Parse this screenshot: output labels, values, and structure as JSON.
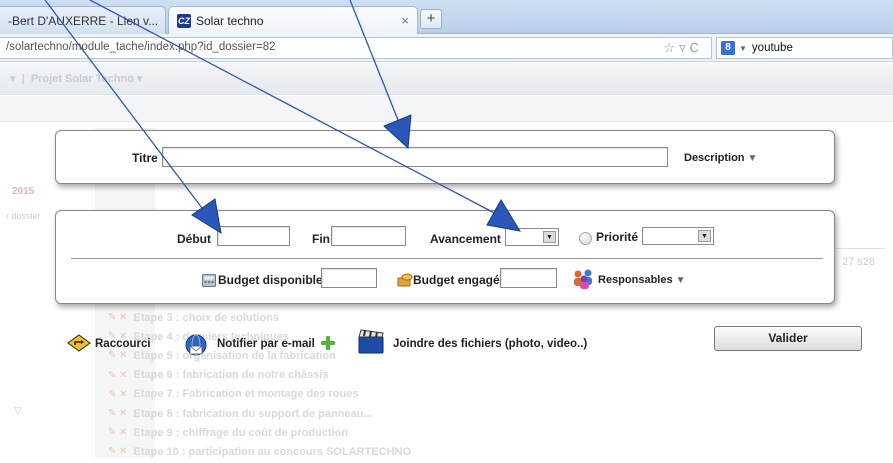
{
  "browser": {
    "tabs": [
      {
        "label": "-Bert D'AUXERRE - Lien v...",
        "active": false
      },
      {
        "label": "Solar techno",
        "active": true
      }
    ],
    "url": "/solartechno/module_tache/index.php?id_dossier=82",
    "search_text": "youtube"
  },
  "background": {
    "breadcrumb": "Projet Solar Techno",
    "year": "2015",
    "dossier": "r dossier",
    "week_numbers": "27  s28",
    "steps": [
      "Etape 3 : choix de solutions",
      "Etape 4 : dossiers techniques",
      "Etape 5 : organisation de la fabrication",
      "Etape 6 : fabrication de notre châssis",
      "Etape 7 : Fabrication et montage des roues",
      "Etape 8 : fabrication du support de panneau...",
      "Etape 9 : chiffrage du coût de production",
      "Etape 10 : participation au concours SOLARTECHNO"
    ]
  },
  "form": {
    "titre_label": "Titre",
    "titre_value": "",
    "description_label": "Description",
    "debut_label": "Début",
    "fin_label": "Fin",
    "avancement_label": "Avancement",
    "priorite_label": "Priorité",
    "budget_disponible_label": "Budget disponible",
    "budget_engage_label": "Budget engagé",
    "responsables_label": "Responsables",
    "raccourci_label": "Raccourci",
    "notifier_label": "Notifier par e-mail",
    "joindre_label": "Joindre des fichiers (photo, video..)",
    "valider_label": "Valider"
  },
  "colors": {
    "arrow": "#2a57b8",
    "panel_border": "#888888"
  }
}
